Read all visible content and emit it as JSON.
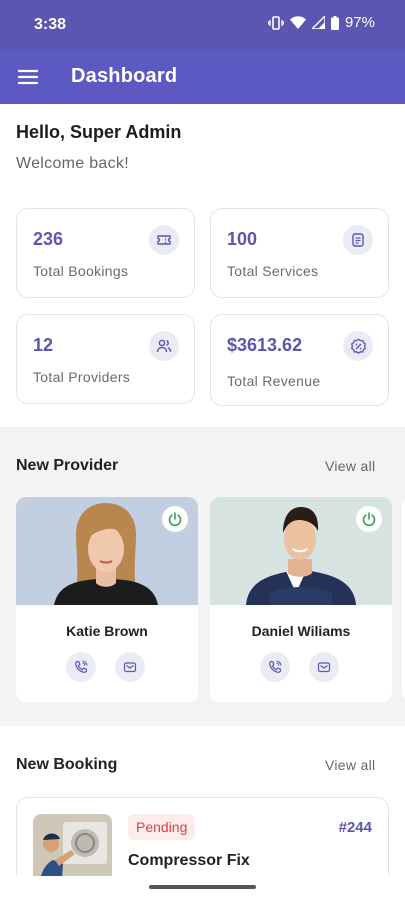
{
  "status_bar": {
    "time": "3:38",
    "battery": "97%"
  },
  "app_bar": {
    "title": "Dashboard",
    "menu_icon": "hamburger-menu-icon"
  },
  "greeting": {
    "hello": "Hello, Super Admin",
    "welcome": "Welcome back!"
  },
  "stats": [
    {
      "value": "236",
      "label": "Total Bookings",
      "icon": "ticket-icon"
    },
    {
      "value": "100",
      "label": "Total Services",
      "icon": "document-list-icon"
    },
    {
      "value": "12",
      "label": "Total Providers",
      "icon": "users-icon"
    },
    {
      "value": "$3613.62",
      "label": "Total Revenue",
      "icon": "badge-percent-icon"
    }
  ],
  "new_provider": {
    "title": "New Provider",
    "view_all": "View all",
    "providers": [
      {
        "name": "Katie Brown"
      },
      {
        "name": "Daniel Wiliams"
      }
    ]
  },
  "new_booking": {
    "title": "New Booking",
    "view_all": "View all",
    "bookings": [
      {
        "status": "Pending",
        "id": "#244",
        "title": "Compressor Fix"
      }
    ]
  },
  "colors": {
    "primary": "#5c59c3",
    "status_bar": "#5a56b2",
    "pending": "#d34545",
    "power_green": "#3aa14a"
  }
}
